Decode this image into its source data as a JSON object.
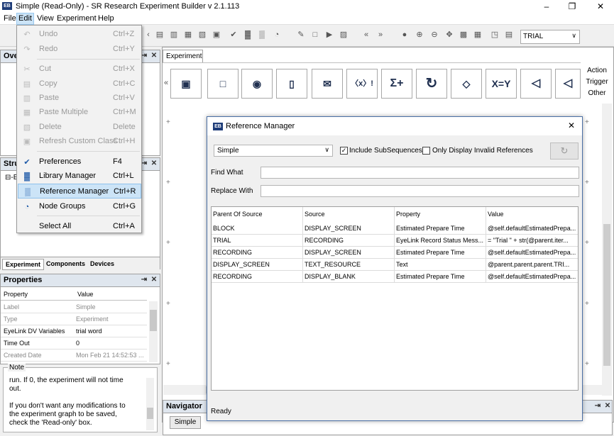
{
  "window": {
    "title": "Simple (Read-Only) - SR Research Experiment Builder v 2.1.113",
    "app_icon": "EB"
  },
  "menubar": {
    "items": [
      "File",
      "Edit",
      "View",
      "Experiment",
      "Help"
    ]
  },
  "edit_menu": {
    "items": [
      {
        "label": "Undo",
        "shortcut": "Ctrl+Z",
        "icon": "undo-icon",
        "enabled": false
      },
      {
        "label": "Redo",
        "shortcut": "Ctrl+Y",
        "icon": "redo-icon",
        "enabled": false
      },
      {
        "label": "Cut",
        "shortcut": "Ctrl+X",
        "icon": "scissors-icon",
        "enabled": false
      },
      {
        "label": "Copy",
        "shortcut": "Ctrl+C",
        "icon": "copy-icon",
        "enabled": false
      },
      {
        "label": "Paste",
        "shortcut": "Ctrl+V",
        "icon": "paste-icon",
        "enabled": false
      },
      {
        "label": "Paste Multiple",
        "shortcut": "Ctrl+M",
        "icon": "paste-multiple-icon",
        "enabled": false
      },
      {
        "label": "Delete",
        "shortcut": "Delete",
        "icon": "delete-icon",
        "enabled": false
      },
      {
        "label": "Refresh Custom Class",
        "shortcut": "Ctrl+H",
        "icon": "refresh-icon",
        "enabled": false
      },
      {
        "label": "Preferences",
        "shortcut": "F4",
        "icon": "preferences-icon",
        "enabled": true
      },
      {
        "label": "Library Manager",
        "shortcut": "Ctrl+L",
        "icon": "library-icon",
        "enabled": true
      },
      {
        "label": "Reference Manager",
        "shortcut": "Ctrl+R",
        "icon": "reference-icon",
        "enabled": true
      },
      {
        "label": "Node Groups",
        "shortcut": "Ctrl+G",
        "icon": "node-groups-icon",
        "enabled": true
      },
      {
        "label": "Select All",
        "shortcut": "Ctrl+A",
        "icon": "",
        "enabled": true
      }
    ]
  },
  "toolbar": {
    "trial_combo": "TRIAL"
  },
  "left": {
    "overview_title": "Ove",
    "structure_title": "Stru",
    "tree_stub": "⊟-E",
    "tabs": [
      "Experiment",
      "Components",
      "Devices"
    ],
    "properties_title": "Properties",
    "properties_headers": [
      "Property",
      "Value"
    ],
    "properties_rows": [
      {
        "name": "Label",
        "value": "Simple",
        "muted": true
      },
      {
        "name": "Type",
        "value": "Experiment",
        "muted": true
      },
      {
        "name": "EyeLink DV Variables",
        "value": "trial word",
        "muted": false
      },
      {
        "name": "Time Out",
        "value": "0",
        "muted": false
      },
      {
        "name": "Created Date",
        "value": "Mon Feb 21 14:52:53 ...",
        "muted": true
      }
    ],
    "note_title": "Note",
    "note_lines": [
      "run.  If 0, the experiment will not time",
      "out.",
      "",
      "If you don't want any modifications to",
      "the experiment graph to be saved,",
      "check the 'Read-only' box."
    ]
  },
  "experiment": {
    "tab": "Experiment",
    "side_tabs": [
      "Action",
      "Trigger",
      "Other"
    ],
    "palette_icons": [
      "display-screen-icon",
      "drift-correct-icon",
      "eye-camera-setup-icon",
      "eyelink-command-icon",
      "send-el-message-icon",
      "null-action-icon",
      "add-to-accumulator-icon",
      "recycle-icon",
      "loop-node-icon",
      "update-attribute-icon",
      "play-sound-icon",
      "sound-control-icon"
    ],
    "palette_text": {
      "null_action": "〈x〉!",
      "accumulator": "Σ+",
      "update_attribute": "X=Y"
    }
  },
  "navigator": {
    "title": "Navigator",
    "button": "Simple"
  },
  "dialog": {
    "title": "Reference Manager",
    "scope_combo": "Simple",
    "include_subsequences": {
      "label": "Include SubSequences",
      "checked": true
    },
    "only_invalid": {
      "label": "Only Display Invalid References",
      "checked": false
    },
    "find_label": "Find What",
    "find_value": "",
    "replace_label": "Replace With",
    "replace_value": "",
    "columns": [
      "Parent Of Source",
      "Source",
      "Property",
      "Value"
    ],
    "rows": [
      [
        "BLOCK",
        "DISPLAY_SCREEN",
        "Estimated Prepare Time",
        "@self.defaultEstimatedPrepa..."
      ],
      [
        "TRIAL",
        "RECORDING",
        "EyeLink Record Status Mess...",
        "= \"Trial \" + str(@parent.iter..."
      ],
      [
        "RECORDING",
        "DISPLAY_SCREEN",
        "Estimated Prepare Time",
        "@self.defaultEstimatedPrepa..."
      ],
      [
        "DISPLAY_SCREEN",
        "TEXT_RESOURCE",
        "Text",
        "@parent.parent.parent.TRI..."
      ],
      [
        "RECORDING",
        "DISPLAY_BLANK",
        "Estimated Prepare Time",
        "@self.defaultEstimatedPrepa..."
      ]
    ],
    "status": "Ready"
  }
}
